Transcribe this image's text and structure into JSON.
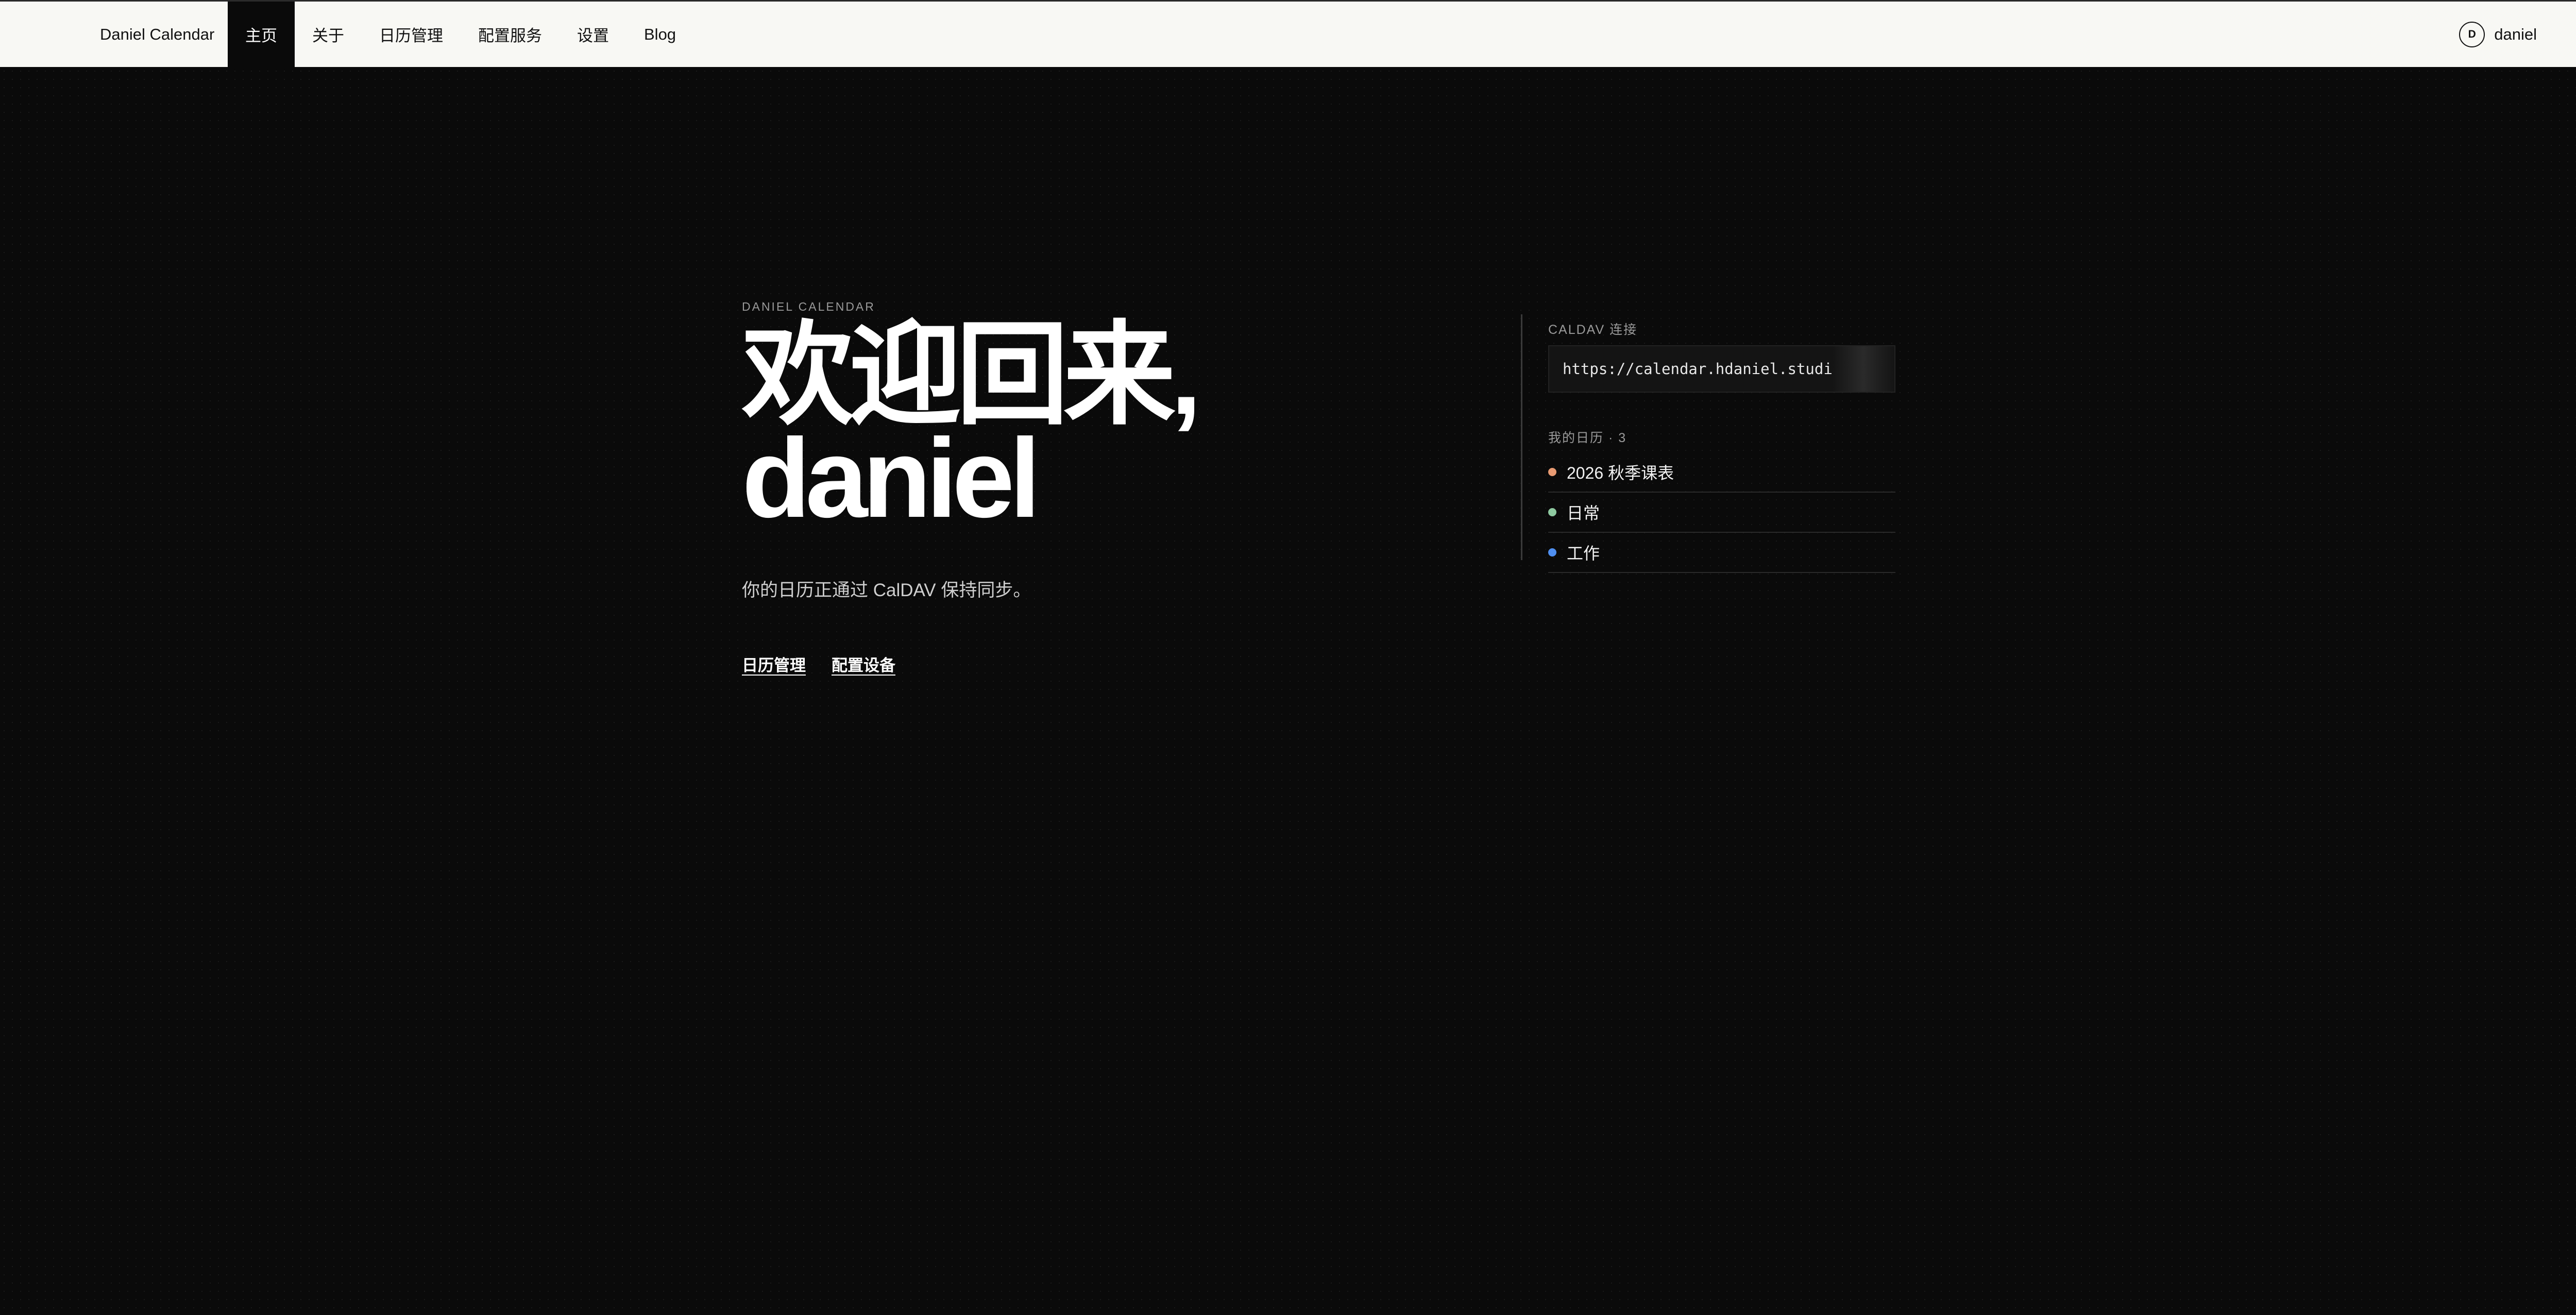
{
  "header": {
    "brand": "Daniel Calendar",
    "nav": [
      {
        "label": "主页",
        "active": true
      },
      {
        "label": "关于"
      },
      {
        "label": "日历管理"
      },
      {
        "label": "配置服务"
      },
      {
        "label": "设置"
      },
      {
        "label": "Blog"
      }
    ],
    "user": {
      "avatar_initial": "D",
      "name": "daniel"
    }
  },
  "hero": {
    "eyebrow": "DANIEL CALENDAR",
    "headline_line1": "欢迎回来,",
    "headline_line2": "daniel",
    "subtitle": "你的日历正通过 CalDAV 保持同步。",
    "actions": [
      {
        "label": "日历管理"
      },
      {
        "label": "配置设备"
      }
    ]
  },
  "panel": {
    "caldav_label": "CALDAV 连接",
    "caldav_url": "https://calendar.hdaniel.studi",
    "calendars_label": "我的日历 · 3",
    "calendars": [
      {
        "name": "2026 秋季课表",
        "color": "#e89a72"
      },
      {
        "name": "日常",
        "color": "#8ec9a0"
      },
      {
        "name": "工作",
        "color": "#4f8ff0"
      }
    ]
  },
  "colors": {
    "background": "#0a0a0a",
    "topbar": "#f8f8f4"
  }
}
